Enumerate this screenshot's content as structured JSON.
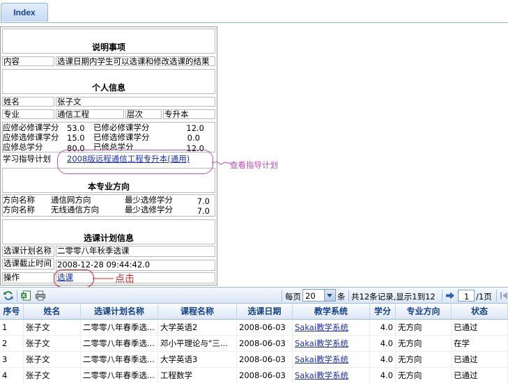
{
  "tab": {
    "label": "Index"
  },
  "notice": {
    "title": "说明事项",
    "label": "内容",
    "value": "选课日期内学生可以选课和修改选课的结果"
  },
  "personal": {
    "title": "个人信息",
    "name_label": "姓名",
    "name": "张子文",
    "major_label": "专业",
    "major": "通信工程",
    "level_label": "层次",
    "level": "专升本",
    "req_label": "应修必修课学分",
    "req_value": "53.0",
    "req_done_label": "已修必修课学分",
    "req_done_value": "12.0",
    "elec_label": "应修选修课学分",
    "elec_value": "15.0",
    "elec_done_label": "已修选修课学分",
    "elec_done_value": "0.0",
    "total_label": "应修总学分",
    "total_value": "80.0",
    "total_done_label": "已修总学分",
    "total_done_value": "12.0",
    "plan_label": "学习指导计划",
    "plan_link": "2008版远程通信工程专升本(通用)"
  },
  "direction": {
    "title": "本专业方向",
    "rows": [
      {
        "label": "方向名称",
        "name": "通信网方向",
        "min_label": "最少选修学分",
        "min": "7.0"
      },
      {
        "label": "方向名称",
        "name": "无线通信方向",
        "min_label": "最少选修学分",
        "min": "7.0"
      }
    ]
  },
  "plan": {
    "title": "选课计划信息",
    "name_label": "选课计划名称",
    "name": "二零零八年秋季选课",
    "deadline_label": "选课截止时间",
    "deadline": "2008-12-28 09:44:42.0",
    "op_label": "操作",
    "op_link": "选课"
  },
  "annotations": {
    "plan_note": "查看指导计划",
    "click_note": "点击"
  },
  "toolbar": {
    "per_page": "每页",
    "page_size": "20",
    "unit": "条",
    "summary": "共12条记录,显示1到12",
    "page": "1",
    "page_total": "/1页"
  },
  "grid": {
    "headers": [
      "序号",
      "姓名",
      "选课计划名称",
      "课程名称",
      "选课日期",
      "教学系统",
      "学分",
      "专业方向",
      "状态"
    ],
    "rows": [
      [
        "1",
        "张子文",
        "二零零八年春季选...",
        "大学英语2",
        "2008-06-03",
        "Sakai教学系统",
        "4.0",
        "无方向",
        "已通过"
      ],
      [
        "2",
        "张子文",
        "二零零八年春季选...",
        "邓小平理论与\"三...",
        "2008-06-03",
        "Sakai教学系统",
        "4.0",
        "无方向",
        "在学"
      ],
      [
        "3",
        "张子文",
        "二零零八年春季选...",
        "大学英语3",
        "2008-06-03",
        "Sakai教学系统",
        "4.0",
        "无方向",
        "已通过"
      ],
      [
        "4",
        "张子文",
        "二零零八年春季选...",
        "工程数学",
        "2008-06-03",
        "Sakai教学系统",
        "4.0",
        "无方向",
        "已通过"
      ]
    ]
  }
}
